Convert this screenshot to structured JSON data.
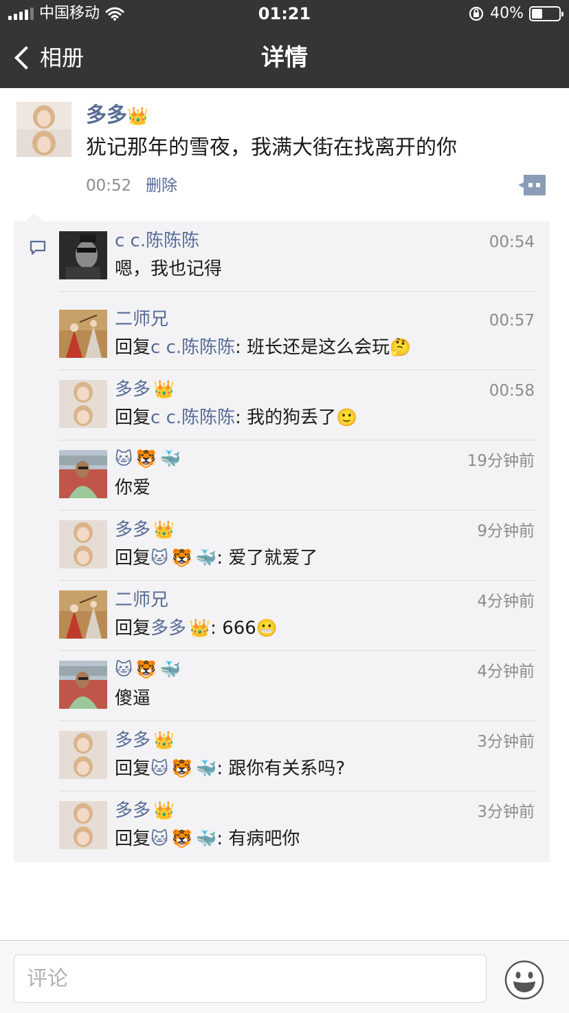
{
  "status_bar": {
    "carrier": "中国移动",
    "time": "01:21",
    "battery_percent": "40%"
  },
  "nav": {
    "back_label": "相册",
    "title": "详情"
  },
  "post": {
    "author": "多多",
    "text": "犹记那年的雪夜，我满大街在找离开的你",
    "time": "00:52",
    "delete_label": "删除"
  },
  "comments": [
    {
      "name": "c c.陈陈陈",
      "time": "00:54",
      "text": "嗯，我也记得"
    },
    {
      "name": "二师兄",
      "time": "00:57",
      "reply_prefix": "回复",
      "reply_to": "c c.陈陈陈",
      "text": ": 班长还是这么会玩"
    },
    {
      "name": "多多",
      "time": "00:58",
      "reply_prefix": "回复",
      "reply_to": "c c.陈陈陈",
      "text": ": 我的狗丢了"
    },
    {
      "name": "",
      "time": "19分钟前",
      "text": "你爱"
    },
    {
      "name": "多多",
      "time": "9分钟前",
      "reply_prefix": "回复",
      "reply_to": "",
      "text": ": 爱了就爱了"
    },
    {
      "name": "二师兄",
      "time": "4分钟前",
      "reply_prefix": "回复",
      "reply_to": "多多",
      "text": ": 666"
    },
    {
      "name": "",
      "time": "4分钟前",
      "text": "傻逼"
    },
    {
      "name": "多多",
      "time": "3分钟前",
      "reply_prefix": "回复",
      "reply_to": "",
      "text": ": 跟你有关系吗?"
    },
    {
      "name": "多多",
      "time": "3分钟前",
      "reply_prefix": "回复",
      "reply_to": "",
      "text": ": 有病吧你"
    }
  ],
  "bottom_bar": {
    "comment_placeholder": "评论"
  },
  "icons": {
    "crown": "crown-icon",
    "cat": "cat-face-icon",
    "tiger": "tiger-face-icon",
    "whale": "whale-icon",
    "thinking": "thinking-face-icon",
    "smile": "smiling-face-icon",
    "grin": "grinning-face-icon",
    "comment_bubble": "comment-bubble-icon",
    "emoji_button": "emoji-face-icon"
  },
  "colors": {
    "header_bg": "#353535",
    "link_blue": "#576b95",
    "comment_bg": "#f3f3f5",
    "timestamp_gray": "#8c8c8c"
  }
}
